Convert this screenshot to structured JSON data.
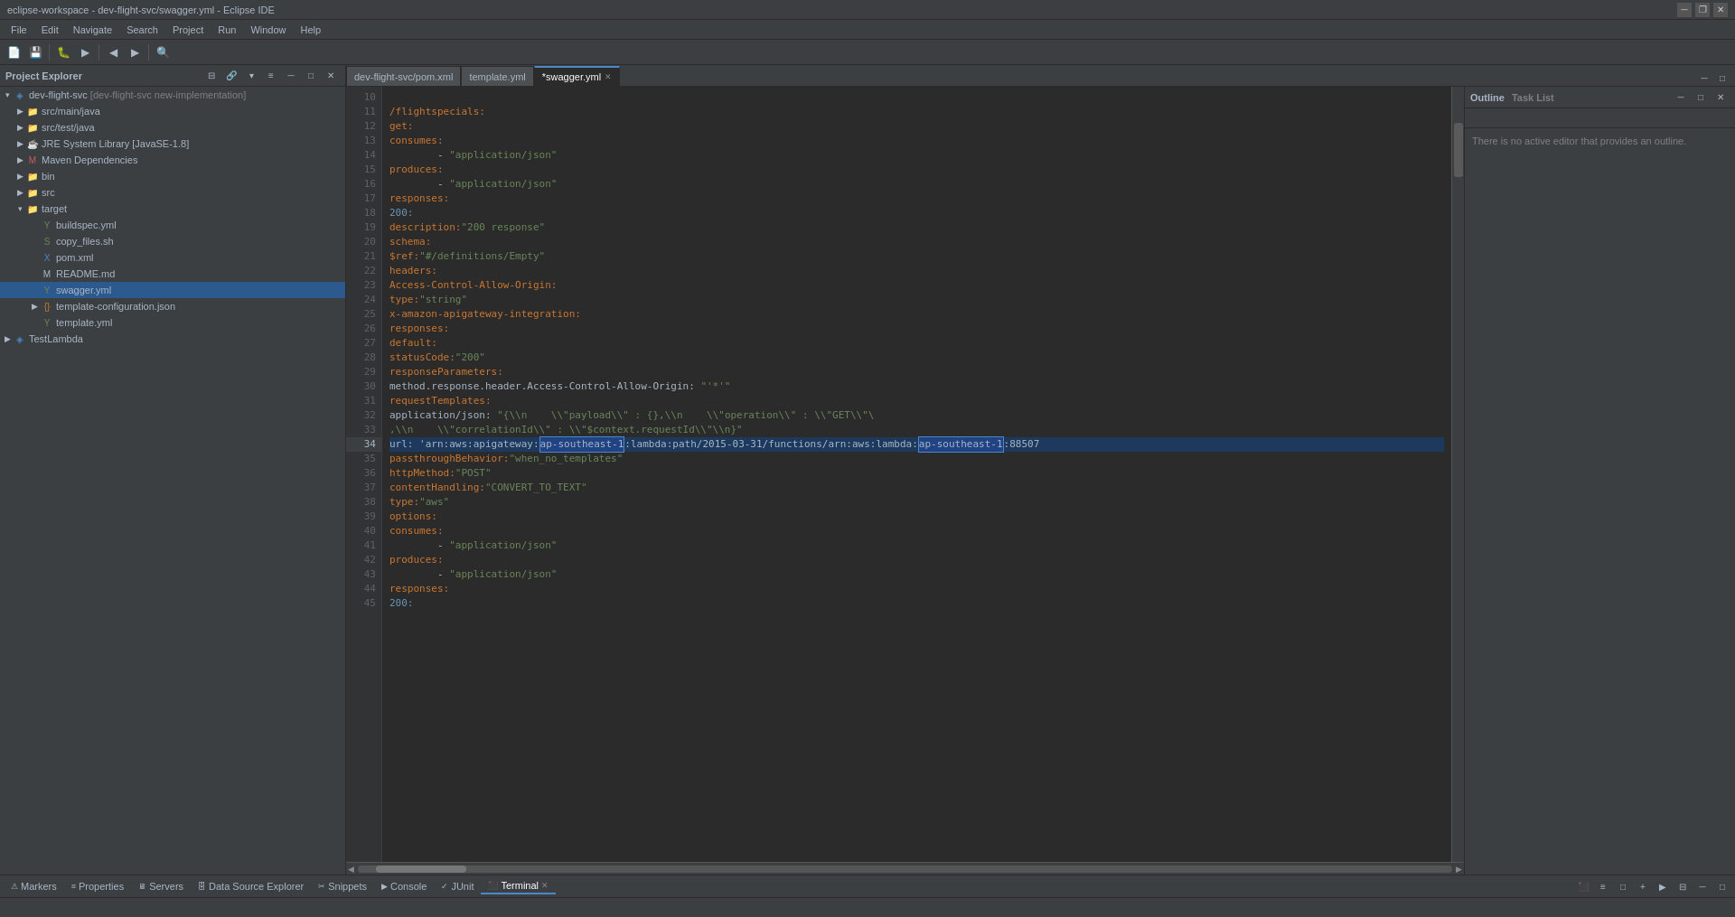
{
  "title_bar": {
    "title": "eclipse-workspace - dev-flight-svc/swagger.yml - Eclipse IDE",
    "controls": [
      "minimize",
      "restore",
      "close"
    ]
  },
  "menu_bar": {
    "items": [
      "File",
      "Edit",
      "Navigate",
      "Search",
      "Project",
      "Run",
      "Window",
      "Help"
    ]
  },
  "tabs": {
    "items": [
      {
        "label": "dev-flight-svc/pom.xml",
        "active": false,
        "closeable": false
      },
      {
        "label": "template.yml",
        "active": false,
        "closeable": false
      },
      {
        "label": "*swagger.yml",
        "active": true,
        "closeable": true
      }
    ]
  },
  "project_explorer": {
    "title": "Project Explorer",
    "tree": [
      {
        "id": "dev-flight-svc",
        "label": "dev-flight-svc [dev-flight-svc new-implementation]",
        "level": 0,
        "expanded": true,
        "type": "project"
      },
      {
        "id": "src-main-java",
        "label": "src/main/java",
        "level": 1,
        "expanded": false,
        "type": "src"
      },
      {
        "id": "src-test-java",
        "label": "src/test/java",
        "level": 1,
        "expanded": false,
        "type": "src"
      },
      {
        "id": "jre",
        "label": "JRE System Library [JavaSE-1.8]",
        "level": 1,
        "expanded": false,
        "type": "lib"
      },
      {
        "id": "maven",
        "label": "Maven Dependencies",
        "level": 1,
        "expanded": false,
        "type": "lib"
      },
      {
        "id": "bin",
        "label": "bin",
        "level": 1,
        "expanded": false,
        "type": "folder"
      },
      {
        "id": "src",
        "label": "src",
        "level": 1,
        "expanded": false,
        "type": "folder"
      },
      {
        "id": "target",
        "label": "target",
        "level": 1,
        "expanded": true,
        "type": "folder"
      },
      {
        "id": "buildspec",
        "label": "buildspec.yml",
        "level": 2,
        "expanded": false,
        "type": "file-yml"
      },
      {
        "id": "copy-files",
        "label": "copy_files.sh",
        "level": 2,
        "expanded": false,
        "type": "file-sh"
      },
      {
        "id": "pom-xml",
        "label": "pom.xml",
        "level": 2,
        "expanded": false,
        "type": "file-xml"
      },
      {
        "id": "readme",
        "label": "README.md",
        "level": 2,
        "expanded": false,
        "type": "file-md"
      },
      {
        "id": "swagger-yml",
        "label": "swagger.yml",
        "level": 2,
        "expanded": false,
        "type": "file-yml",
        "selected": true
      },
      {
        "id": "template-config",
        "label": "template-configuration.json",
        "level": 2,
        "expanded": false,
        "type": "file-json"
      },
      {
        "id": "template-yml",
        "label": "template.yml",
        "level": 2,
        "expanded": false,
        "type": "file-yml"
      },
      {
        "id": "testlambda",
        "label": "TestLambda",
        "level": 1,
        "expanded": false,
        "type": "project"
      }
    ]
  },
  "code_editor": {
    "lines": [
      {
        "num": 10,
        "content": ""
      },
      {
        "num": 11,
        "content": "  /flightspecials:"
      },
      {
        "num": 12,
        "content": "    get:"
      },
      {
        "num": 13,
        "content": "      consumes:"
      },
      {
        "num": 14,
        "content": "        - \"application/json\""
      },
      {
        "num": 15,
        "content": "      produces:"
      },
      {
        "num": 16,
        "content": "        - \"application/json\""
      },
      {
        "num": 17,
        "content": "      responses:"
      },
      {
        "num": 18,
        "content": "        200:"
      },
      {
        "num": 19,
        "content": "          description: \"200 response\""
      },
      {
        "num": 20,
        "content": "          schema:"
      },
      {
        "num": 21,
        "content": "            $ref: \"#/definitions/Empty\""
      },
      {
        "num": 22,
        "content": "          headers:"
      },
      {
        "num": 23,
        "content": "            Access-Control-Allow-Origin:"
      },
      {
        "num": 24,
        "content": "              type: \"string\""
      },
      {
        "num": 25,
        "content": "      x-amazon-apigateway-integration:"
      },
      {
        "num": 26,
        "content": "        responses:"
      },
      {
        "num": 27,
        "content": "          default:"
      },
      {
        "num": 28,
        "content": "            statusCode: \"200\""
      },
      {
        "num": 29,
        "content": "            responseParameters:"
      },
      {
        "num": 30,
        "content": "              method.response.header.Access-Control-Allow-Origin: \"'*'\""
      },
      {
        "num": 31,
        "content": "        requestTemplates:"
      },
      {
        "num": 32,
        "content": "          application/json: \"{\\n    \\\"payload\\\" : {},\\n    \\\"operation\\\" : \\\"GET\\\"\\"
      },
      {
        "num": 33,
        "content": "           ,\\n    \\\"correlationId\\\" : \\\"$context.requestId\\\"\\n}\""
      },
      {
        "num": 34,
        "content": "        url: 'arn:aws:apigateway:ap-southeast-1:lambda:path/2015-03-31/functions/arn:aws:lambda:ap-southeast-1:88507",
        "highlight": true
      },
      {
        "num": 35,
        "content": "        passthroughBehavior: \"when_no_templates\""
      },
      {
        "num": 36,
        "content": "        httpMethod: \"POST\""
      },
      {
        "num": 37,
        "content": "        contentHandling: \"CONVERT_TO_TEXT\""
      },
      {
        "num": 38,
        "content": "        type: \"aws\""
      },
      {
        "num": 39,
        "content": "    options:"
      },
      {
        "num": 40,
        "content": "      consumes:"
      },
      {
        "num": 41,
        "content": "        - \"application/json\""
      },
      {
        "num": 42,
        "content": "      produces:"
      },
      {
        "num": 43,
        "content": "        - \"application/json\""
      },
      {
        "num": 44,
        "content": "      responses:"
      },
      {
        "num": 45,
        "content": "        200:"
      }
    ]
  },
  "outline_panel": {
    "tabs": [
      "Outline",
      "Task List"
    ],
    "content": "There is no active editor that provides an outline."
  },
  "bottom_tabs": {
    "items": [
      {
        "label": "Markers",
        "icon": "marker-icon",
        "active": false
      },
      {
        "label": "Properties",
        "icon": "properties-icon",
        "active": false
      },
      {
        "label": "Servers",
        "icon": "server-icon",
        "active": false
      },
      {
        "label": "Data Source Explorer",
        "icon": "datasource-icon",
        "active": false
      },
      {
        "label": "Snippets",
        "icon": "snippets-icon",
        "active": false
      },
      {
        "label": "Console",
        "icon": "console-icon",
        "active": false
      },
      {
        "label": "JUnit",
        "icon": "junit-icon",
        "active": false
      },
      {
        "label": "Terminal",
        "icon": "terminal-icon",
        "active": true,
        "closeable": true
      }
    ]
  },
  "status_bar": {
    "text": ""
  },
  "colors": {
    "bg_dark": "#2b2b2b",
    "bg_medium": "#3c3f41",
    "bg_light": "#4c5052",
    "accent": "#4a88c7",
    "text_main": "#a9b7c6",
    "text_dim": "#606366",
    "keyword": "#cc7832",
    "string": "#6a8759",
    "number": "#6897bb",
    "highlight": "#214283"
  }
}
